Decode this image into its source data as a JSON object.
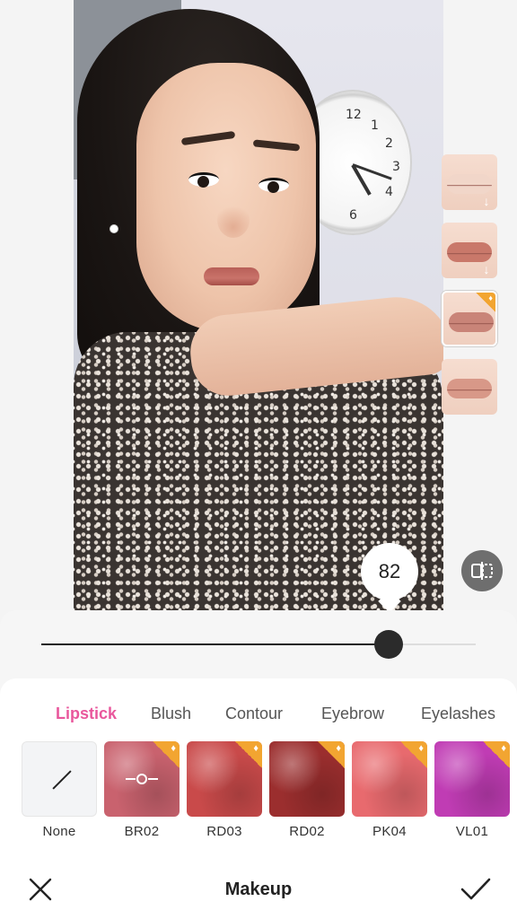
{
  "slider": {
    "value": "82",
    "fraction": 0.8
  },
  "tabs": [
    {
      "label": "Lipstick",
      "active": true
    },
    {
      "label": "Blush",
      "active": false
    },
    {
      "label": "Contour",
      "active": false
    },
    {
      "label": "Eyebrow",
      "active": false
    },
    {
      "label": "Eyelashes",
      "active": false
    }
  ],
  "swatches": [
    {
      "label": "None",
      "color": "#f3f4f6",
      "premium": false
    },
    {
      "label": "BR02",
      "color": "#c9626e",
      "premium": true,
      "selected": true
    },
    {
      "label": "RD03",
      "color": "#c94a4a",
      "premium": true
    },
    {
      "label": "RD02",
      "color": "#9b2e2e",
      "premium": true
    },
    {
      "label": "PK04",
      "color": "#e86a6e",
      "premium": true
    },
    {
      "label": "VL01",
      "color": "#c03cb4",
      "premium": true
    }
  ],
  "presets": [
    {
      "name": "preset-lip-1",
      "lip_color": "#f1d6c9",
      "download": true,
      "premium": false
    },
    {
      "name": "preset-lip-2",
      "lip_color": "#c9786a",
      "download": true,
      "premium": false
    },
    {
      "name": "preset-lip-3",
      "lip_color": "#c98478",
      "download": false,
      "premium": true,
      "selected": true
    },
    {
      "name": "preset-lip-4",
      "lip_color": "#d89888",
      "download": false,
      "premium": false
    }
  ],
  "footer": {
    "title": "Makeup"
  },
  "colors": {
    "accent": "#e9579c",
    "premium_badge": "#f2a531"
  }
}
